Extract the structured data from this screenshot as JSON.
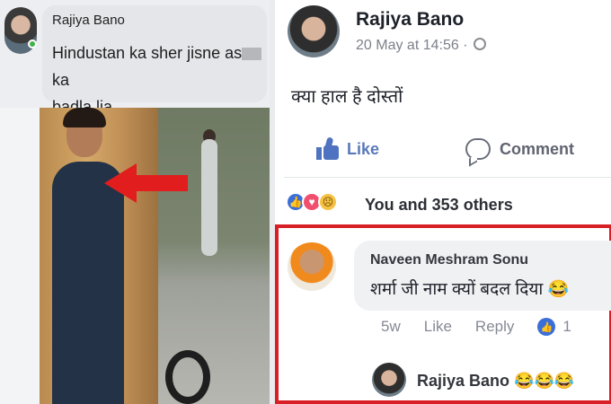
{
  "left_post": {
    "author": "Rajiya Bano",
    "text_line1_a": "Hindustan ka sher jisne as",
    "text_line1_b": "ka",
    "text_line2": "badla lia"
  },
  "right_post": {
    "author": "Rajiya Bano",
    "timestamp": "20 May at 14:56 ·",
    "text": "क्या हाल है दोस्तों",
    "actions": {
      "like": "Like",
      "comment": "Comment"
    },
    "reactions_text": "You and 353 others",
    "comment": {
      "author": "Naveen Meshram Sonu",
      "text": "शर्मा जी नाम क्यों बदल दिया 😂",
      "age": "5w",
      "like": "Like",
      "reply": "Reply",
      "like_count": "1"
    },
    "reply": {
      "author": "Rajiya Bano",
      "emoji": "😂😂😂"
    }
  },
  "colors": {
    "accent_red": "#d91f26",
    "fb_blue": "#4f73c0"
  }
}
